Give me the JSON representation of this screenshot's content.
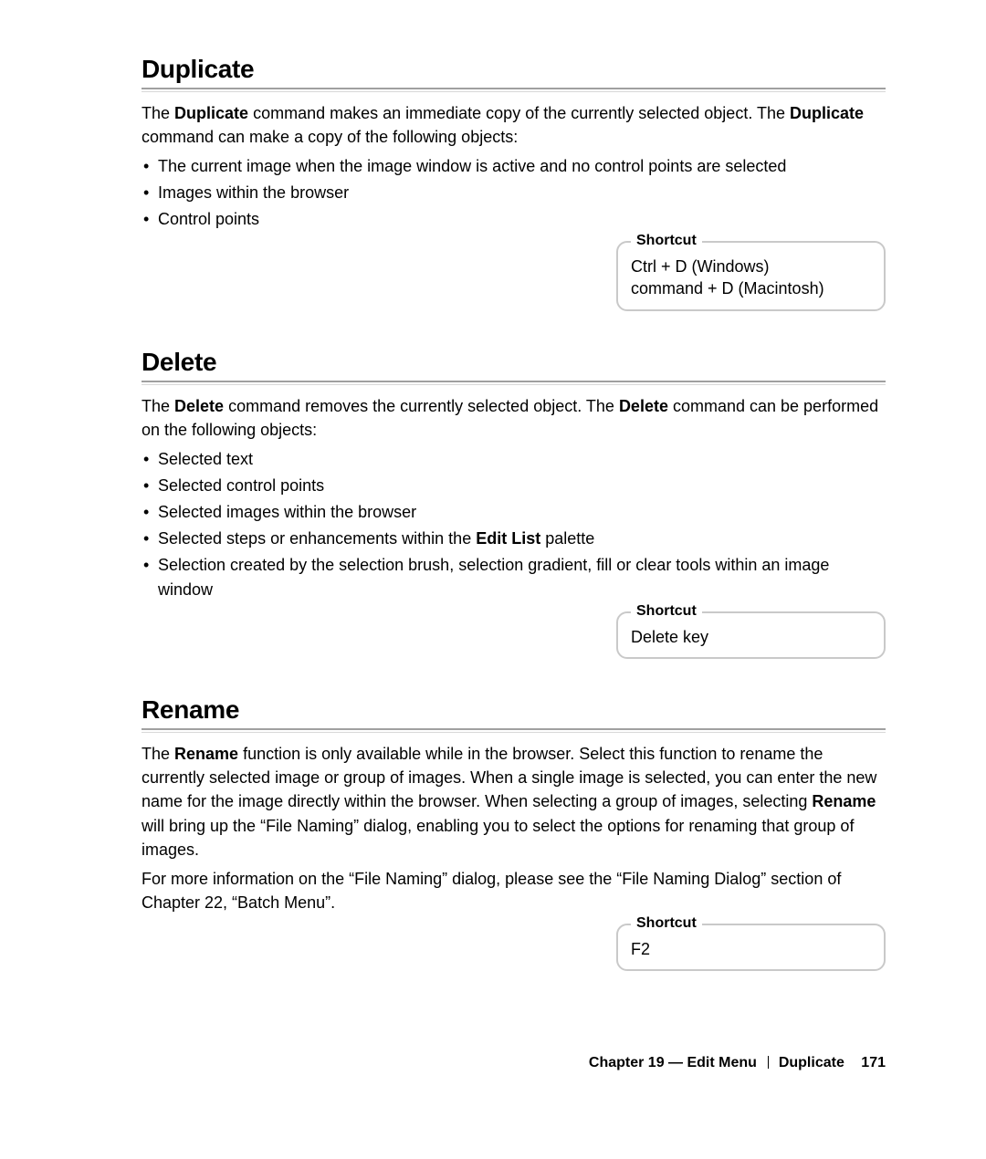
{
  "sections": {
    "duplicate": {
      "heading": "Duplicate",
      "para_pre": "The ",
      "para_bold1": "Duplicate",
      "para_mid": " command makes an immediate copy of the currently selected object. The ",
      "para_bold2": "Duplicate",
      "para_post": " command can make a copy of the following objects:",
      "bullets": [
        "The current image when the image window is active and no control points are selected",
        "Images within the browser",
        "Control points"
      ],
      "shortcut": {
        "label": "Shortcut",
        "lines": [
          "Ctrl + D (Windows)",
          "command + D (Macintosh)"
        ]
      }
    },
    "delete": {
      "heading": "Delete",
      "para_pre": "The ",
      "para_bold1": "Delete",
      "para_mid": " command removes the currently selected object. The ",
      "para_bold2": "Delete",
      "para_post": " command can be performed on the following objects:",
      "bullets_plain": [
        "Selected text",
        "Selected control points",
        "Selected images within the browser"
      ],
      "bullet4_pre": "Selected steps or enhancements within the ",
      "bullet4_bold": "Edit List",
      "bullet4_post": " palette",
      "bullet5": "Selection created by the selection brush, selection gradient, fill or clear tools within an image window",
      "shortcut": {
        "label": "Shortcut",
        "lines": [
          "Delete key"
        ]
      }
    },
    "rename": {
      "heading": "Rename",
      "para1_pre": "The ",
      "para1_bold1": "Rename",
      "para1_mid": " function is only available while in the browser. Select this function to rename the currently selected image or group of images. When a single image is selected, you can enter the new name for the image directly within the browser. When selecting a group of images, selecting ",
      "para1_bold2": "Rename",
      "para1_post": " will bring up the “File Naming” dialog, enabling you to select the options for renaming that group of images.",
      "para2": "For more information on the “File Naming” dialog, please see the “File Naming Dialog” section of Chapter 22, “Batch Menu”.",
      "shortcut": {
        "label": "Shortcut",
        "lines": [
          "F2"
        ]
      }
    }
  },
  "footer": {
    "chapter": "Chapter 19 — Edit Menu",
    "crumb": "Duplicate",
    "page": "171"
  }
}
